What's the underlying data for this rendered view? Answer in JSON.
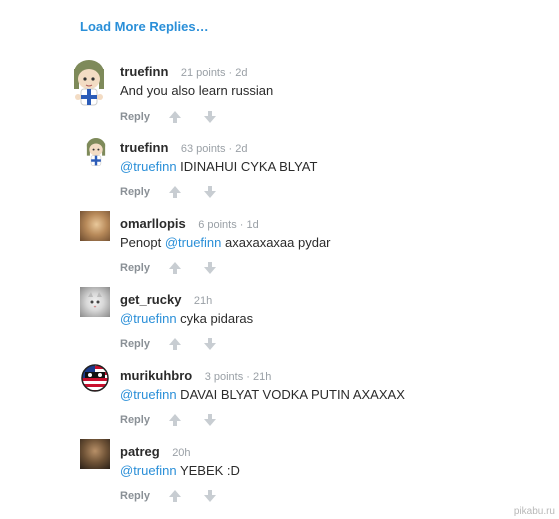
{
  "load_more_label": "Load More Replies…",
  "reply_label": "Reply",
  "comments": [
    {
      "username": "truefinn",
      "points": "21 points · 2d",
      "mention": "",
      "text": "And you also learn russian",
      "avatar": "anime-character-finnish-flag"
    },
    {
      "username": "truefinn",
      "points": "63 points · 2d",
      "mention": "@truefinn",
      "text": " IDINAHUI CYKA BLYAT",
      "avatar": "anime-character-finnish-flag"
    },
    {
      "username": "omarllopis",
      "points": "6 points · 1d",
      "mention": "@truefinn",
      "text_before": "Penopt ",
      "text": " axaxaxaxaa pydar",
      "avatar": "photo"
    },
    {
      "username": "get_rucky",
      "points": "21h",
      "mention": "@truefinn",
      "text": " cyka pidaras",
      "avatar": "cat-photo"
    },
    {
      "username": "murikuhbro",
      "points": "3 points · 21h",
      "mention": "@truefinn",
      "text": " DAVAI BLYAT VODKA PUTIN AXAXAX",
      "avatar": "usa-countryball"
    },
    {
      "username": "patreg",
      "points": "20h",
      "mention": "@truefinn",
      "text": " YEBEK :D",
      "avatar": "photo"
    }
  ],
  "watermark": "pikabu.ru",
  "colors": {
    "link": "#2a8fd8",
    "meta": "#9aa0a6",
    "vote": "#c8cdd2"
  }
}
